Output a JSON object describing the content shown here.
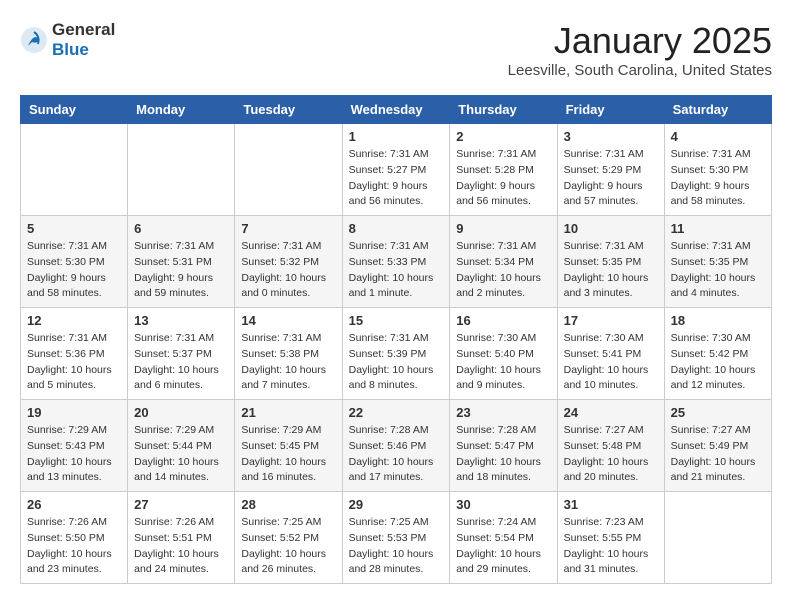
{
  "header": {
    "logo_general": "General",
    "logo_blue": "Blue",
    "month_title": "January 2025",
    "location": "Leesville, South Carolina, United States"
  },
  "days_of_week": [
    "Sunday",
    "Monday",
    "Tuesday",
    "Wednesday",
    "Thursday",
    "Friday",
    "Saturday"
  ],
  "weeks": [
    [
      {
        "day": "",
        "sunrise": "",
        "sunset": "",
        "daylight": ""
      },
      {
        "day": "",
        "sunrise": "",
        "sunset": "",
        "daylight": ""
      },
      {
        "day": "",
        "sunrise": "",
        "sunset": "",
        "daylight": ""
      },
      {
        "day": "1",
        "sunrise": "Sunrise: 7:31 AM",
        "sunset": "Sunset: 5:27 PM",
        "daylight": "Daylight: 9 hours and 56 minutes."
      },
      {
        "day": "2",
        "sunrise": "Sunrise: 7:31 AM",
        "sunset": "Sunset: 5:28 PM",
        "daylight": "Daylight: 9 hours and 56 minutes."
      },
      {
        "day": "3",
        "sunrise": "Sunrise: 7:31 AM",
        "sunset": "Sunset: 5:29 PM",
        "daylight": "Daylight: 9 hours and 57 minutes."
      },
      {
        "day": "4",
        "sunrise": "Sunrise: 7:31 AM",
        "sunset": "Sunset: 5:30 PM",
        "daylight": "Daylight: 9 hours and 58 minutes."
      }
    ],
    [
      {
        "day": "5",
        "sunrise": "Sunrise: 7:31 AM",
        "sunset": "Sunset: 5:30 PM",
        "daylight": "Daylight: 9 hours and 58 minutes."
      },
      {
        "day": "6",
        "sunrise": "Sunrise: 7:31 AM",
        "sunset": "Sunset: 5:31 PM",
        "daylight": "Daylight: 9 hours and 59 minutes."
      },
      {
        "day": "7",
        "sunrise": "Sunrise: 7:31 AM",
        "sunset": "Sunset: 5:32 PM",
        "daylight": "Daylight: 10 hours and 0 minutes."
      },
      {
        "day": "8",
        "sunrise": "Sunrise: 7:31 AM",
        "sunset": "Sunset: 5:33 PM",
        "daylight": "Daylight: 10 hours and 1 minute."
      },
      {
        "day": "9",
        "sunrise": "Sunrise: 7:31 AM",
        "sunset": "Sunset: 5:34 PM",
        "daylight": "Daylight: 10 hours and 2 minutes."
      },
      {
        "day": "10",
        "sunrise": "Sunrise: 7:31 AM",
        "sunset": "Sunset: 5:35 PM",
        "daylight": "Daylight: 10 hours and 3 minutes."
      },
      {
        "day": "11",
        "sunrise": "Sunrise: 7:31 AM",
        "sunset": "Sunset: 5:35 PM",
        "daylight": "Daylight: 10 hours and 4 minutes."
      }
    ],
    [
      {
        "day": "12",
        "sunrise": "Sunrise: 7:31 AM",
        "sunset": "Sunset: 5:36 PM",
        "daylight": "Daylight: 10 hours and 5 minutes."
      },
      {
        "day": "13",
        "sunrise": "Sunrise: 7:31 AM",
        "sunset": "Sunset: 5:37 PM",
        "daylight": "Daylight: 10 hours and 6 minutes."
      },
      {
        "day": "14",
        "sunrise": "Sunrise: 7:31 AM",
        "sunset": "Sunset: 5:38 PM",
        "daylight": "Daylight: 10 hours and 7 minutes."
      },
      {
        "day": "15",
        "sunrise": "Sunrise: 7:31 AM",
        "sunset": "Sunset: 5:39 PM",
        "daylight": "Daylight: 10 hours and 8 minutes."
      },
      {
        "day": "16",
        "sunrise": "Sunrise: 7:30 AM",
        "sunset": "Sunset: 5:40 PM",
        "daylight": "Daylight: 10 hours and 9 minutes."
      },
      {
        "day": "17",
        "sunrise": "Sunrise: 7:30 AM",
        "sunset": "Sunset: 5:41 PM",
        "daylight": "Daylight: 10 hours and 10 minutes."
      },
      {
        "day": "18",
        "sunrise": "Sunrise: 7:30 AM",
        "sunset": "Sunset: 5:42 PM",
        "daylight": "Daylight: 10 hours and 12 minutes."
      }
    ],
    [
      {
        "day": "19",
        "sunrise": "Sunrise: 7:29 AM",
        "sunset": "Sunset: 5:43 PM",
        "daylight": "Daylight: 10 hours and 13 minutes."
      },
      {
        "day": "20",
        "sunrise": "Sunrise: 7:29 AM",
        "sunset": "Sunset: 5:44 PM",
        "daylight": "Daylight: 10 hours and 14 minutes."
      },
      {
        "day": "21",
        "sunrise": "Sunrise: 7:29 AM",
        "sunset": "Sunset: 5:45 PM",
        "daylight": "Daylight: 10 hours and 16 minutes."
      },
      {
        "day": "22",
        "sunrise": "Sunrise: 7:28 AM",
        "sunset": "Sunset: 5:46 PM",
        "daylight": "Daylight: 10 hours and 17 minutes."
      },
      {
        "day": "23",
        "sunrise": "Sunrise: 7:28 AM",
        "sunset": "Sunset: 5:47 PM",
        "daylight": "Daylight: 10 hours and 18 minutes."
      },
      {
        "day": "24",
        "sunrise": "Sunrise: 7:27 AM",
        "sunset": "Sunset: 5:48 PM",
        "daylight": "Daylight: 10 hours and 20 minutes."
      },
      {
        "day": "25",
        "sunrise": "Sunrise: 7:27 AM",
        "sunset": "Sunset: 5:49 PM",
        "daylight": "Daylight: 10 hours and 21 minutes."
      }
    ],
    [
      {
        "day": "26",
        "sunrise": "Sunrise: 7:26 AM",
        "sunset": "Sunset: 5:50 PM",
        "daylight": "Daylight: 10 hours and 23 minutes."
      },
      {
        "day": "27",
        "sunrise": "Sunrise: 7:26 AM",
        "sunset": "Sunset: 5:51 PM",
        "daylight": "Daylight: 10 hours and 24 minutes."
      },
      {
        "day": "28",
        "sunrise": "Sunrise: 7:25 AM",
        "sunset": "Sunset: 5:52 PM",
        "daylight": "Daylight: 10 hours and 26 minutes."
      },
      {
        "day": "29",
        "sunrise": "Sunrise: 7:25 AM",
        "sunset": "Sunset: 5:53 PM",
        "daylight": "Daylight: 10 hours and 28 minutes."
      },
      {
        "day": "30",
        "sunrise": "Sunrise: 7:24 AM",
        "sunset": "Sunset: 5:54 PM",
        "daylight": "Daylight: 10 hours and 29 minutes."
      },
      {
        "day": "31",
        "sunrise": "Sunrise: 7:23 AM",
        "sunset": "Sunset: 5:55 PM",
        "daylight": "Daylight: 10 hours and 31 minutes."
      },
      {
        "day": "",
        "sunrise": "",
        "sunset": "",
        "daylight": ""
      }
    ]
  ]
}
